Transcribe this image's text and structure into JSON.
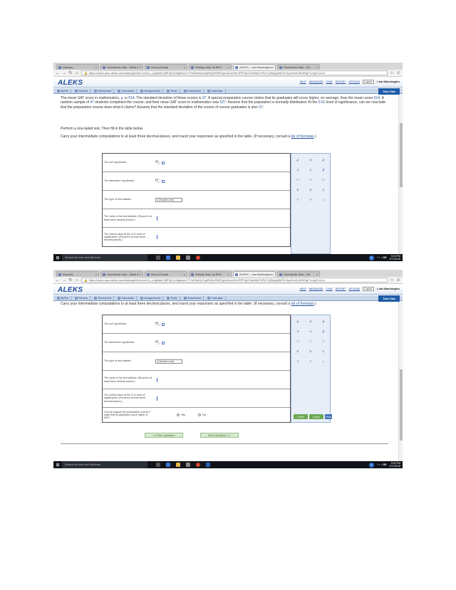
{
  "browser": {
    "tabs": [
      "Wizards",
      "Homework Help - Math X",
      "Inbox (Gmail)",
      "Writing Help: ALEKS",
      "ALEKS - Lisa Washington",
      "Homework Help - Sh"
    ],
    "active_tab_index": 4,
    "url": "https://www-awu.aleks.com/alekscgi/x/Isl.exe/1o_u-IgNslkr7j8P3jH-lvNgbwon7YYsE6uWy7wyR0QeR5BTgnLNuxbZnLRPFbjvC3wN5pTxPk?1QWpyiy5b7N-Dyo9xvfLJtMIGlg7 tuJyj7d-cXz",
    "accent": "#1f5ca8"
  },
  "aleks": {
    "logo": "ALEKS",
    "top_links": [
      "HELP",
      "MESSAGES",
      "CHAT",
      "REPORT",
      "OPTIONS"
    ],
    "logout": "Logout",
    "username": "Lisa Washington",
    "menu": [
      "MyPie",
      "Review",
      "Worksheet",
      "Calculator",
      "Assignments",
      "Tests",
      "Gradebook",
      "Calendar"
    ],
    "take_stat": "Take Stat"
  },
  "problem": {
    "p1a": "The mean SAT score in mathematics, ",
    "mu": "μ",
    "p1b": ", is ",
    "mean": "514",
    "p1c": ". The standard deviation of these scores is ",
    "sd": "37",
    "p1d": ". A special preparation course claims that its graduates will score higher, on average, than the mean score ",
    "mean2": "514",
    "p1e": ". A random sample of ",
    "n": "47",
    "p1f": " students completed the course, and their mean SAT score in mathematics was ",
    "xbar": "527",
    "p1g": ". Assume that the population is normally distributed. At the ",
    "alpha": "0.01",
    "p1h": " level of significance, can we conclude that the preparation course does what it claims? Assume that the standard deviation of the scores of course graduates is also ",
    "sd2": "37",
    "p1i": ".",
    "p2": "Perform a one-tailed test. Then fill in the table below.",
    "p3a": "Carry your intermediate computations to at least three decimal places, and round your responses as specified in the table. (If necessary, consult a ",
    "p3_link": "list of formulas",
    "p3b": ".)"
  },
  "table": {
    "null_label": "The null hypothesis:",
    "alt_label": "The alternative hypothesis:",
    "stat_label": "The type of test statistic:",
    "stat_value": "(Choose one)",
    "value_label": "The value of the test statistic: (Round to at least three decimal places.)",
    "critical_label": "The critical value at the 0.01 level of significance: (Round to at least three decimal places.)",
    "conclude_label": "Can we support the preparation course's claim that its graduates score higher in SAT?",
    "yes": "Yes",
    "no": "No",
    "H0": "H",
    "H0_sub": "0",
    "H0_tail": ":",
    "H1": "H",
    "H1_sub": "1",
    "H1_tail": ":"
  },
  "palette": {
    "symbols": [
      "μ",
      "σ",
      "p",
      "x̄",
      "s",
      "p̂",
      "□",
      "□",
      "□",
      "≤",
      "≥",
      "≠",
      "<",
      ">",
      "="
    ],
    "clear": "Clear",
    "undo": "Undo",
    "help": "Help"
  },
  "nav": {
    "prev": "<< Prev Question",
    "next": "Next Question >>"
  },
  "taskbar": {
    "search": "Search the web and Windows",
    "time": "5:03 PM",
    "date": "2/17/2016"
  }
}
